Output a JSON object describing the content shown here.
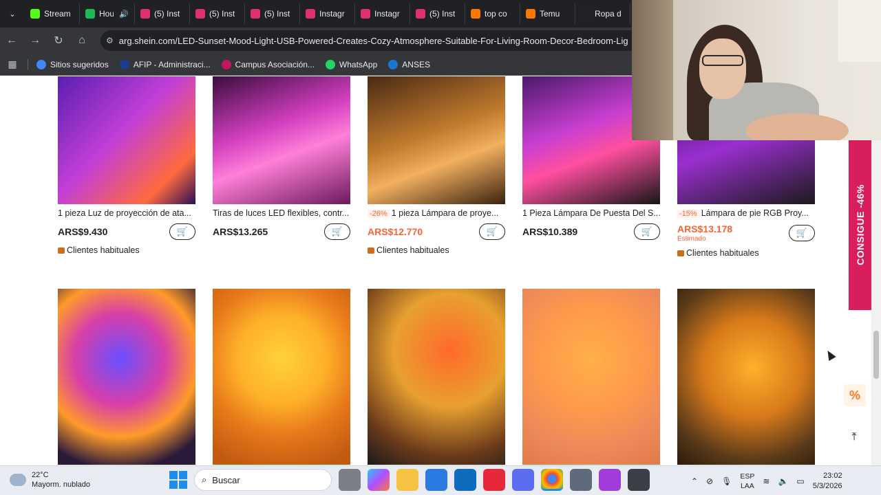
{
  "browser": {
    "tabs": [
      {
        "label": "Stream",
        "favicon_color": "#53fc18"
      },
      {
        "label": "Hou",
        "favicon_color": "#1db954",
        "audio": "🔊"
      },
      {
        "label": "(5) Inst",
        "favicon_color": "#e1306c"
      },
      {
        "label": "(5) Inst",
        "favicon_color": "#e1306c"
      },
      {
        "label": "(5) Inst",
        "favicon_color": "#e1306c"
      },
      {
        "label": "Instagr",
        "favicon_color": "#e1306c"
      },
      {
        "label": "Instagr",
        "favicon_color": "#e1306c"
      },
      {
        "label": "(5) Inst",
        "favicon_color": "#e1306c"
      },
      {
        "label": "top co",
        "favicon_color": "#fb7701"
      },
      {
        "label": "Temu",
        "favicon_color": "#fb7701"
      },
      {
        "label": "Ropa d",
        "favicon_color": "#222222"
      }
    ],
    "url": "arg.shein.com/LED-Sunset-Mood-Light-USB-Powered-Creates-Cozy-Atmosphere-Suitable-For-Living-Room-Decor-Bedroom-Lig",
    "bookmarks": [
      {
        "label": "Sitios sugeridos",
        "color": "#4285f4"
      },
      {
        "label": "AFIP - Administraci...",
        "color": "#1a3d8f"
      },
      {
        "label": "Campus Asociación...",
        "color": "#c2185b"
      },
      {
        "label": "WhatsApp",
        "color": "#25d366"
      },
      {
        "label": "ANSES",
        "color": "#1976d2"
      }
    ]
  },
  "products_row1": [
    {
      "title": "1 pieza Luz de proyección de ata...",
      "discount": "",
      "price": "ARS$9.430",
      "sale": false,
      "estimated": "",
      "club": "Clientes habituales",
      "img": "linear-gradient(135deg,#5a1fb0 0%,#c13fd8 45%,#ff6a3d 80%,#2a0f55 100%)"
    },
    {
      "title": "Tiras de luces LED flexibles, contr...",
      "discount": "",
      "price": "ARS$13.265",
      "sale": false,
      "estimated": "",
      "club": "",
      "img": "linear-gradient(160deg,#3b0d3f 0%,#d23fbf 40%,#ff7fd8 60%,#6a1a5e 100%)"
    },
    {
      "title": "1 pieza Lámpara de proye...",
      "discount": "-26%",
      "price": "ARS$12.770",
      "sale": true,
      "estimated": "",
      "club": "Clientes habituales",
      "img": "linear-gradient(160deg,#4a2a12 0%,#c07a2e 45%,#f2b060 65%,#3a2210 100%)"
    },
    {
      "title": "1 Pieza Lámpara De Puesta Del S...",
      "discount": "",
      "price": "ARS$10.389",
      "sale": false,
      "estimated": "",
      "club": "",
      "img": "linear-gradient(160deg,#4a1a6a 0%,#c83fd0 40%,#ff4fa0 60%,#161616 100%)"
    },
    {
      "title": "Lámpara de pie RGB Proy...",
      "discount": "-15%",
      "price": "ARS$13.178",
      "sale": true,
      "estimated": "Estimado",
      "club": "Clientes habituales",
      "img": "linear-gradient(160deg,#3a0d55 0%,#9a2fd0 50%,#1a1a1a 100%)"
    }
  ],
  "products_row2": [
    {
      "img": "radial-gradient(circle at 45% 40%,#6a4fff 0%,#d83fa8 35%,#ff9a2a 60%,#2a1a3a 85%)"
    },
    {
      "img": "radial-gradient(circle at 50% 40%,#ffd23a 0%,#ffb02a 35%,#e87a1a 60%,#c25a12 90%)"
    },
    {
      "img": "radial-gradient(circle at 60% 35%,#ff6a2a 0%,#e8a030 40%,#6a3a1a 75%,#1a1a1a 100%)"
    },
    {
      "img": "radial-gradient(circle at 50% 40%,#ffb04a 0%,#ff9a4a 40%,#ef8a5a 70%,#e07a4a 100%)"
    },
    {
      "img": "radial-gradient(circle at 55% 45%,#ffb02a 0%,#d87a1a 40%,#5a3a1a 75%,#2a1a0a 100%)"
    }
  ],
  "promo": {
    "text": "CONSIGUE -46%",
    "color": "#d81e5b",
    "pct": "%",
    "top_arrow": "⤒"
  },
  "taskbar": {
    "temp": "22°C",
    "weather": "Mayorm. nublado",
    "search_placeholder": "Buscar",
    "lang1": "ESP",
    "lang2": "LAA",
    "time": "23:02",
    "date": "5/3/2026"
  }
}
